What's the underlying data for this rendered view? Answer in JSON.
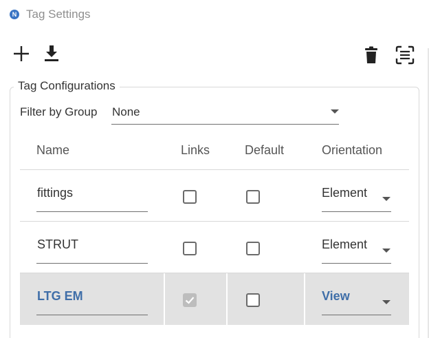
{
  "window": {
    "logo_letter": "N",
    "title": "Tag Settings"
  },
  "toolbar": {
    "add_icon": "plus-icon",
    "download_icon": "download-icon",
    "delete_icon": "trash-icon",
    "scan_icon": "scan-icon"
  },
  "config": {
    "legend": "Tag Configurations",
    "filter_label": "Filter by Group",
    "filter_value": "None"
  },
  "table": {
    "headers": {
      "name": "Name",
      "links": "Links",
      "default": "Default",
      "orientation": "Orientation"
    },
    "rows": [
      {
        "name": "fittings",
        "links": false,
        "default": false,
        "orientation": "Element",
        "selected": false
      },
      {
        "name": "STRUT",
        "links": false,
        "default": false,
        "orientation": "Element",
        "selected": false
      },
      {
        "name": "LTG EM",
        "links": true,
        "default": false,
        "orientation": "View",
        "selected": true
      }
    ]
  },
  "colors": {
    "accent": "#3f6ea8",
    "logo": "#3a74c4",
    "selected_row": "#e2e2e2",
    "disabled_check": "#bdbdbd"
  }
}
